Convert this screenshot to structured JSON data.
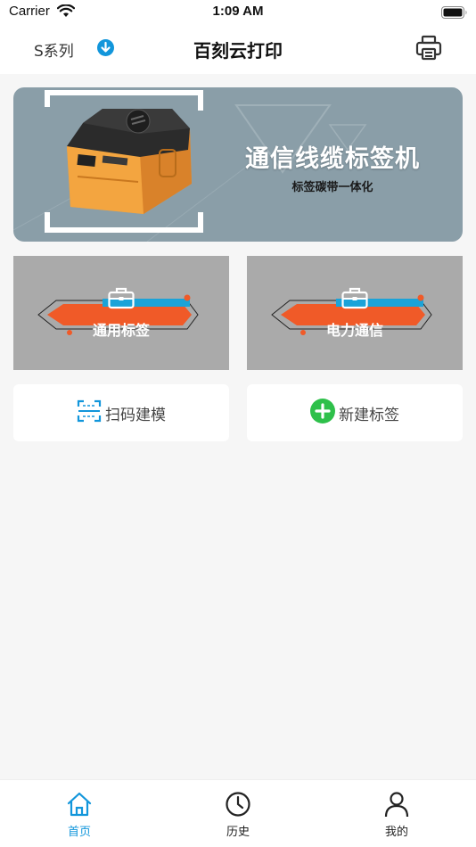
{
  "status_bar": {
    "carrier": "Carrier",
    "time": "1:09 AM"
  },
  "header": {
    "series_label": "S系列",
    "title": "百刻云打印"
  },
  "banner": {
    "title": "通信线缆标签机",
    "subtitle": "标签碳带一体化"
  },
  "categories": [
    {
      "label": "通用标签"
    },
    {
      "label": "电力通信"
    }
  ],
  "actions": {
    "scan_label": "扫码建模",
    "new_label": "新建标签"
  },
  "tabs": [
    {
      "label": "首页",
      "active": true
    },
    {
      "label": "历史",
      "active": false
    },
    {
      "label": "我的",
      "active": false
    }
  ],
  "colors": {
    "accent": "#1296db",
    "banner_bg": "#8a9ea8",
    "card_bg": "#aaaaaa",
    "ribbon_orange": "#f05a28",
    "ribbon_blue": "#1ba3d8",
    "add_green": "#2ec04a"
  }
}
